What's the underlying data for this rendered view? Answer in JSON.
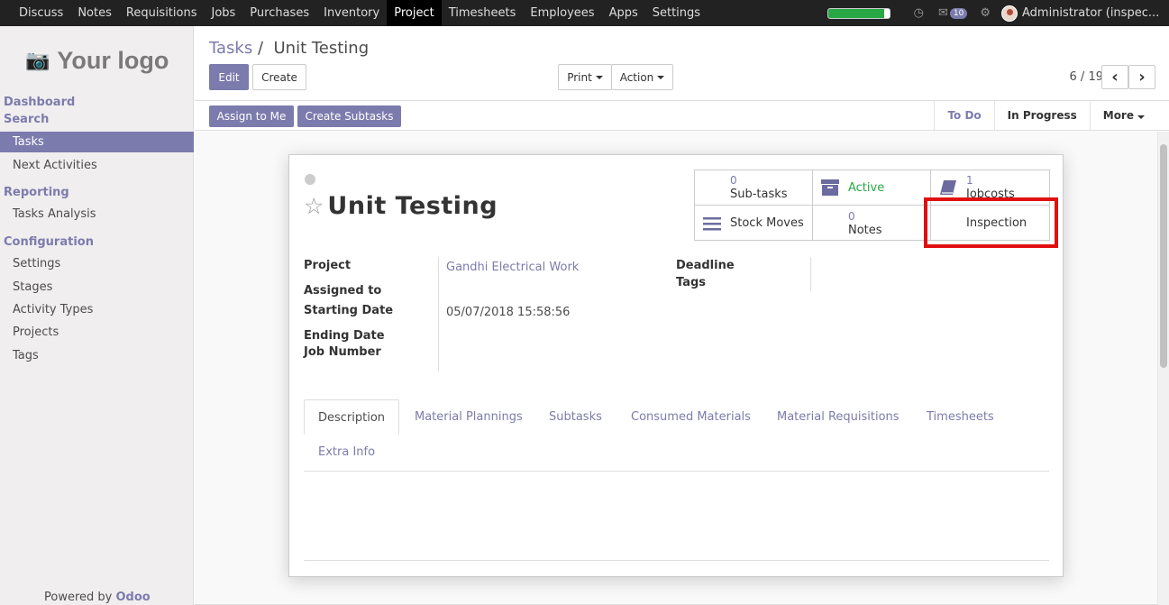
{
  "topbar": {
    "menu": [
      "Discuss",
      "Notes",
      "Requisitions",
      "Jobs",
      "Purchases",
      "Inventory",
      "Project",
      "Timesheets",
      "Employees",
      "Apps",
      "Settings"
    ],
    "active_menu": "Project",
    "progress": 0.92,
    "notification_count": "10",
    "user": "Administrator (inspec..."
  },
  "sidebar": {
    "logo_text": "Your logo",
    "dashboard": "Dashboard",
    "search": "Search",
    "tasks": "Tasks",
    "next_activities": "Next Activities",
    "reporting": "Reporting",
    "tasks_analysis": "Tasks Analysis",
    "configuration": "Configuration",
    "settings": "Settings",
    "stages": "Stages",
    "activity_types": "Activity Types",
    "projects": "Projects",
    "tags": "Tags",
    "powered_prefix": "Powered by",
    "powered_brand": "Odoo"
  },
  "control": {
    "breadcrumb_parent": "Tasks",
    "breadcrumb_sep": "/",
    "breadcrumb_current": "Unit Testing",
    "edit": "Edit",
    "create": "Create",
    "print": "Print",
    "action": "Action",
    "pager": "6 / 19",
    "prev": "‹",
    "next": "›"
  },
  "statusbar": {
    "assign_to_me": "Assign to Me",
    "create_subtasks": "Create Subtasks",
    "to_do": "To Do",
    "in_progress": "In Progress",
    "more": "More"
  },
  "form": {
    "title": "Unit Testing",
    "smart_buttons": {
      "subtasks_count": "0",
      "subtasks_label": "Sub-tasks",
      "active_label": "Active",
      "jobcosts_count": "1",
      "jobcosts_label": "Jobcosts",
      "stock_moves_label": "Stock Moves",
      "notes_count": "0",
      "notes_label": "Notes",
      "inspection_label": "Inspection"
    },
    "fields": {
      "project_label": "Project",
      "project_value": "Gandhi Electrical Work",
      "assigned_to_label": "Assigned to",
      "starting_date_label": "Starting Date",
      "starting_date_value": "05/07/2018 15:58:56",
      "ending_date_label": "Ending Date",
      "job_number_label": "Job Number",
      "deadline_label": "Deadline",
      "tags_label": "Tags"
    },
    "tabs": [
      "Description",
      "Material Plannings",
      "Subtasks",
      "Consumed Materials",
      "Material Requisitions",
      "Timesheets",
      "Extra Info"
    ]
  },
  "colors": {
    "brand": "#7c7bad",
    "highlight": "#e01010",
    "active_green": "#28a745"
  }
}
